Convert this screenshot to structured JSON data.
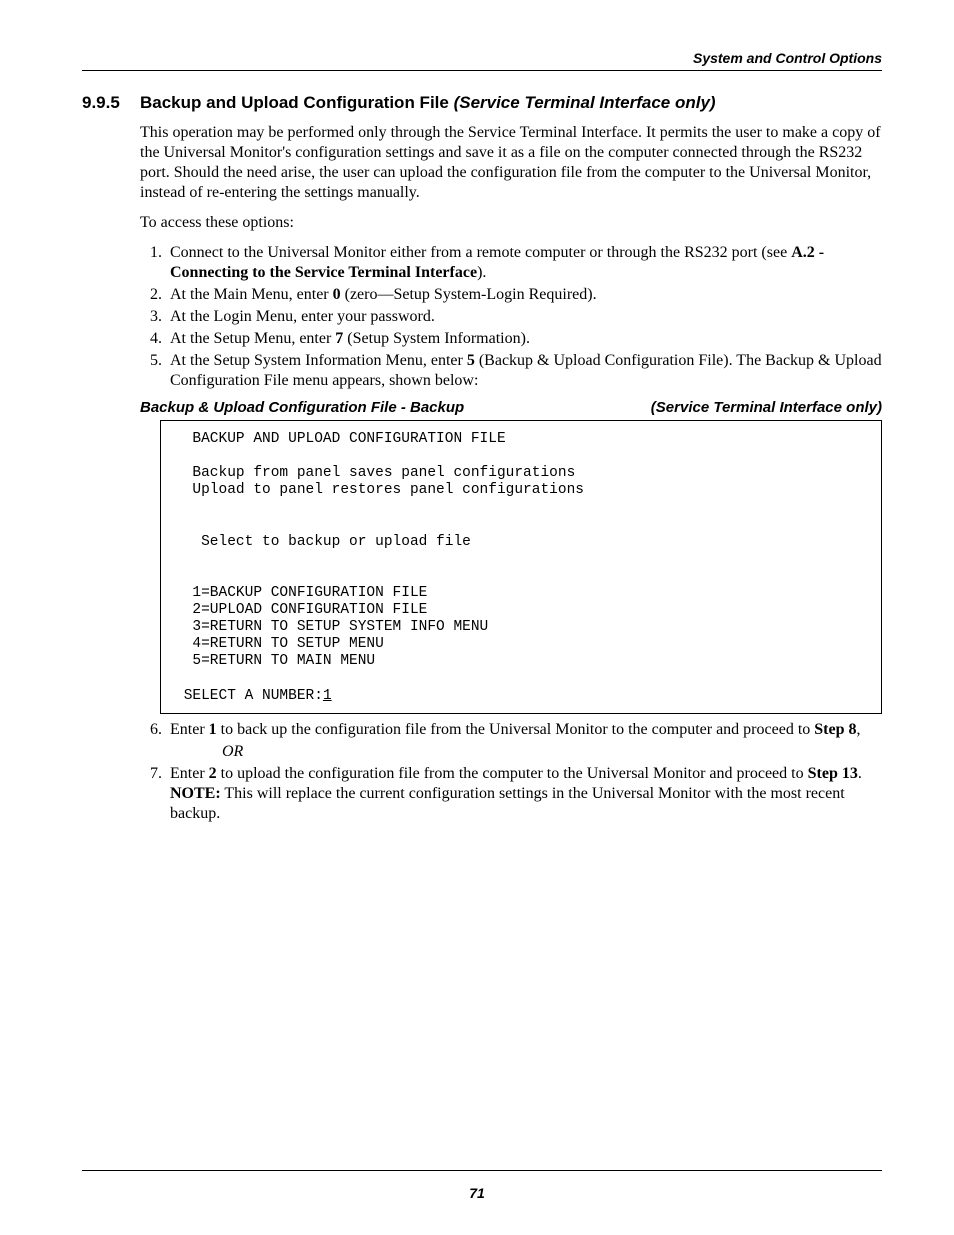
{
  "running_head": "System and Control Options",
  "section": {
    "number": "9.9.5",
    "title_plain": "Backup and Upload Configuration File ",
    "title_italic": "(Service Terminal Interface only)"
  },
  "intro_para": "This operation may be performed only through the Service Terminal Interface. It permits the user to make a copy of the Universal Monitor's configuration settings and save it as a file on the computer connected through the RS232 port. Should the need arise, the user can upload the configuration file from the computer to the Universal Monitor, instead of re-entering the settings manually.",
  "access_para": "To access these options:",
  "steps_1_5": {
    "s1_a": "Connect to the Universal Monitor either from a remote computer or through the RS232 port (see ",
    "s1_b": "A.2 - Connecting to the Service Terminal Interface",
    "s1_c": ").",
    "s2_a": "At the Main Menu, enter ",
    "s2_b": "0",
    "s2_c": " (zero—Setup System-Login Required).",
    "s3": "At the Login Menu, enter your password.",
    "s4_a": "At the Setup Menu, enter ",
    "s4_b": "7",
    "s4_c": " (Setup System Information).",
    "s5_a": "At the Setup System Information Menu, enter ",
    "s5_b": "5",
    "s5_c": " (Backup & Upload Configuration File). The Backup & Upload Configuration File menu appears, shown below:"
  },
  "subhead": {
    "left": "Backup & Upload Configuration File - Backup",
    "right": "(Service Terminal Interface only)"
  },
  "terminal": {
    "l1": "  BACKUP AND UPLOAD CONFIGURATION FILE",
    "l2": "",
    "l3": "  Backup from panel saves panel configurations",
    "l4": "  Upload to panel restores panel configurations",
    "l5": "",
    "l6": "",
    "l7": "   Select to backup or upload file",
    "l8": "",
    "l9": "",
    "l10": "  1=BACKUP CONFIGURATION FILE",
    "l11": "  2=UPLOAD CONFIGURATION FILE",
    "l12": "  3=RETURN TO SETUP SYSTEM INFO MENU",
    "l13": "  4=RETURN TO SETUP MENU",
    "l14": "  5=RETURN TO MAIN MENU",
    "l15": "",
    "l16_a": " SELECT A NUMBER:",
    "l16_b": "1"
  },
  "steps_6_7": {
    "s6_a": "Enter ",
    "s6_b": "1",
    "s6_c": " to back up the configuration file from the Universal Monitor to the computer and proceed to ",
    "s6_d": "Step 8",
    "s6_e": ",",
    "or": "OR",
    "s7_a": "Enter ",
    "s7_b": "2",
    "s7_c": " to upload the configuration file from the computer to the Universal Monitor and proceed to ",
    "s7_d": "Step 13",
    "s7_e": ". ",
    "s7_f": "NOTE:",
    "s7_g": " This will replace the current configuration settings in the Universal Monitor with the most recent backup."
  },
  "page_number": "71"
}
